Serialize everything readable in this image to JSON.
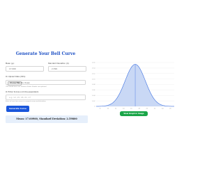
{
  "form": {
    "title": "Generate Your Bell Curve",
    "mean_label": "Mean (μ):",
    "mean_value": "17.000",
    "sd_label": "Standard Deviation (σ):",
    "sd_value": "2.399",
    "upload_label": "Or Upload Data (CSV):",
    "file_button": "Choose File",
    "file_status": "No file chosen",
    "upload_hint": "CSV should have one column of data. Header row optional.",
    "scores_label": "Or Enter Scores (comma-separated):",
    "scores_placeholder": "e.g. 12, 15, 18, 21, 17",
    "scores_hint": "Enter at least two scores to compute mean and deviation.",
    "generate_button": "Generate Curve",
    "stats_text": "Mean: 17.00900, Standard Deviation: 2.59800"
  },
  "chart_data": {
    "type": "area",
    "series": [
      {
        "mean": 17.009,
        "sd": 2.598
      }
    ],
    "x_ticks": [
      "8",
      "10",
      "12",
      "14",
      "16",
      "18",
      "20",
      "22",
      "24",
      "26"
    ],
    "y_ticks": [
      "0.16",
      "0.14",
      "0.12",
      "0.10",
      "0.08",
      "0.06",
      "0.04",
      "0.02",
      "0"
    ],
    "xlim": [
      7,
      27
    ],
    "ylim": [
      0,
      0.16
    ],
    "center_line": true,
    "grid": true,
    "line_color": "#3b6fe0",
    "fill_color": "#c9d8f5"
  },
  "view_button": "View Graph in Image",
  "colors": {
    "title": "#1c4fc4",
    "generate_button": "#1a56db",
    "view_button": "#1aa548",
    "stats_bg": "#e6effb"
  }
}
